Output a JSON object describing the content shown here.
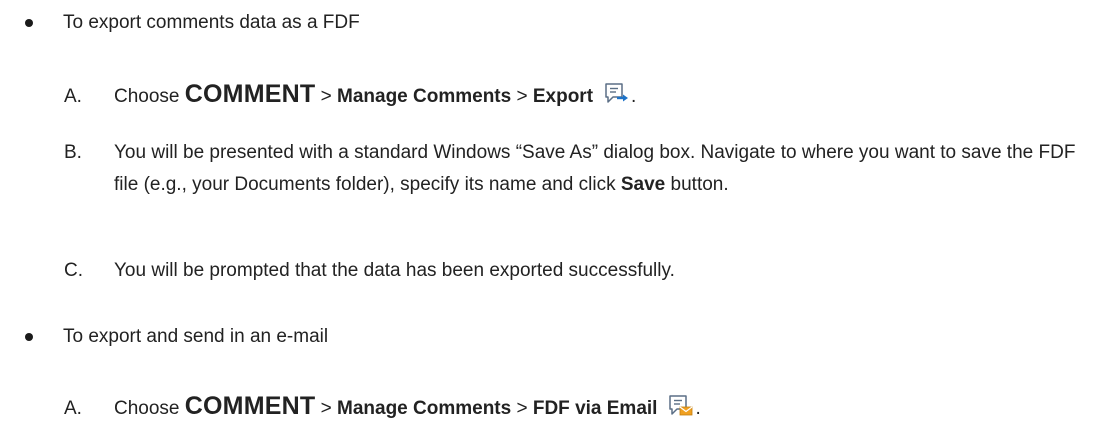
{
  "section1": {
    "bullet": "To export comments data as a FDF",
    "stepA": {
      "letter": "A.",
      "choose": "Choose ",
      "tab": "COMMENT",
      "sep1": " > ",
      "group": "Manage Comments",
      "sep2": " > ",
      "command": "Export",
      "icon": "export-comments-icon",
      "end": "."
    },
    "stepB": {
      "letter": "B.",
      "text": "You will be presented with a standard Windows “Save As” dialog box. Navigate to where you want to save the FDF file (e.g., your Documents folder), specify its name and click ",
      "bold": "Save",
      "tail": " button."
    },
    "stepC": {
      "letter": "C.",
      "text": "You will be prompted that the data has been exported successfully."
    }
  },
  "section2": {
    "bullet": "To export and send in an e-mail",
    "stepA": {
      "letter": "A.",
      "choose": "Choose ",
      "tab": "COMMENT",
      "sep1": " > ",
      "group": "Manage Comments",
      "sep2": " > ",
      "command": "FDF via Email",
      "icon": "fdf-via-email-icon",
      "end": "."
    }
  },
  "colors": {
    "text": "#222222",
    "icon_outline": "#5b6f86",
    "arrow_blue": "#1e73c8",
    "envelope_orange": "#f0a020"
  }
}
